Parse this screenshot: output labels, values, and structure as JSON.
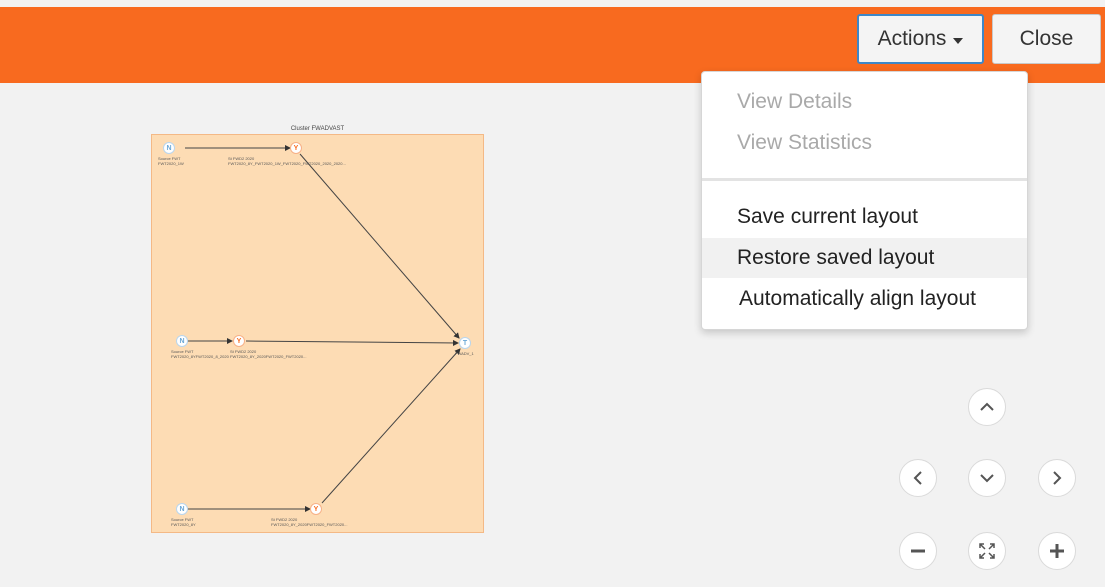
{
  "toolbar": {
    "actions_label": "Actions",
    "close_label": "Close"
  },
  "menu": {
    "items": [
      {
        "label": "View Details",
        "enabled": false
      },
      {
        "label": "View Statistics",
        "enabled": false
      },
      {
        "label": "Save current layout",
        "enabled": true
      },
      {
        "label": "Restore saved layout",
        "enabled": true
      },
      {
        "label": "Automatically align layout",
        "enabled": true
      }
    ]
  },
  "graph": {
    "cluster_title": "Cluster FWADVAST",
    "nodes": {
      "n1": {
        "icon": "N",
        "text1": "Source FWT",
        "text2": "FWT2020_1W"
      },
      "f1": {
        "icon": "Y",
        "text1": "St FWD2 2020",
        "text2": "FWT2020_8Y_FWT2020_1W_FWT2020_FWT2020_2020_2020..."
      },
      "n2": {
        "icon": "N",
        "text1": "Source FWT",
        "text2": "FWT2020_8YFWT2020_8_2020"
      },
      "f2": {
        "icon": "Y",
        "text1": "St FWD2 2020",
        "text2": "FWT2020_8Y_2020FWT2020_FWT2020..."
      },
      "n3": {
        "icon": "N",
        "text1": "Source FWT",
        "text2": "FWT2020_8Y"
      },
      "f3": {
        "icon": "Y",
        "text1": "St FWD2 2020",
        "text2": "FWT2020_8Y_2020FWT2020_FWT2020..."
      },
      "t1": {
        "icon": "T",
        "text1": "FWADV_1",
        "text2": ""
      }
    }
  },
  "colors": {
    "header": "#f86a1f",
    "accent_border": "#3d87c8",
    "canvas_fill": "#fddcb4"
  },
  "nav_icons": [
    "chevron-up-icon",
    "chevron-left-icon",
    "chevron-down-icon",
    "chevron-right-icon",
    "zoom-out-icon",
    "fit-screen-icon",
    "zoom-in-icon"
  ]
}
